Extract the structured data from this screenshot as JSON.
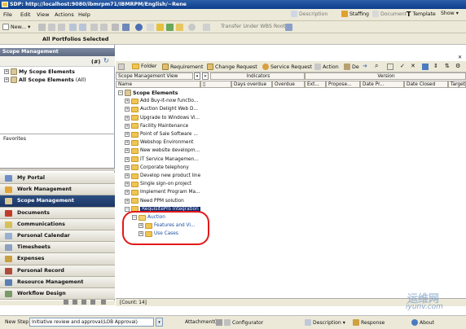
{
  "window": {
    "title": "SDP: http://localhost:9080/ibmrpm71/IBMRPM/English/~Rene"
  },
  "menubar": {
    "items": [
      "File",
      "Edit",
      "View",
      "Actions",
      "Help"
    ],
    "right_buttons": [
      "Description",
      "Staffing",
      "Document",
      "Template",
      "Show"
    ]
  },
  "toolbar1": {
    "new_label": "New...",
    "transfer_label": "Transfer Under WBS Root"
  },
  "portfolio_bar": {
    "label": "All Portfolios Selected"
  },
  "left_panel": {
    "title": "Scope Management",
    "counter": "(#)",
    "tree": [
      {
        "label": "My Scope Elements",
        "suffix": ""
      },
      {
        "label": "All Scope Elements",
        "suffix": "(All)"
      }
    ],
    "favorites_label": "Favorites"
  },
  "nav": {
    "items": [
      "My Portal",
      "Work Management",
      "Scope Management",
      "Documents",
      "Communications",
      "Personal Calendar",
      "Timesheets",
      "Expenses",
      "Personal Record",
      "Resource Management",
      "Workflow Design"
    ],
    "selected": "Scope Management"
  },
  "main_toolbar": {
    "items": [
      "Folder",
      "Requirement",
      "Change Request",
      "Service Request",
      "Action",
      "De"
    ]
  },
  "grid": {
    "view_label": "Scope Management View",
    "groups": [
      "Indicators",
      "Version"
    ],
    "columns": [
      "Name",
      "Days overdue",
      "Overdue",
      "Ext...",
      "Propose...",
      "Date Pr...",
      "Date Closed",
      "Target"
    ],
    "root": "Scope Elements",
    "rows": [
      "Add Buy-it-now functio...",
      "Auction Delight Web D...",
      "Upgrade to Windows Vi...",
      "Facility Maintenance",
      "Point of Sale Software ...",
      "Webshop Environment",
      "New website developm...",
      "IT Service Managemen...",
      "Corporate telephony",
      "Develop new product line",
      "Single sign-on project",
      "Implement Program Ma...",
      "Need PPM solution"
    ],
    "selected_row": "RequisitePro Integration",
    "child": "Auction",
    "grandchildren": [
      "Features and Vi...",
      "Use Cases"
    ]
  },
  "status": {
    "count": "[Count: 14]"
  },
  "bottom": {
    "step_label": "New Step",
    "step_value": "Initiative review and approval(LOB Approval)",
    "attachments": "Attachment(s)",
    "configurator": "Configurator",
    "description": "Description",
    "response": "Response",
    "about": "About"
  },
  "watermark": {
    "text": "运维网",
    "sub": "iyunv.com"
  },
  "colors": {
    "nav_selected": "#1c3564",
    "highlight": "#0a246a",
    "folder": "#f1c552",
    "annotation": "#e31919"
  }
}
